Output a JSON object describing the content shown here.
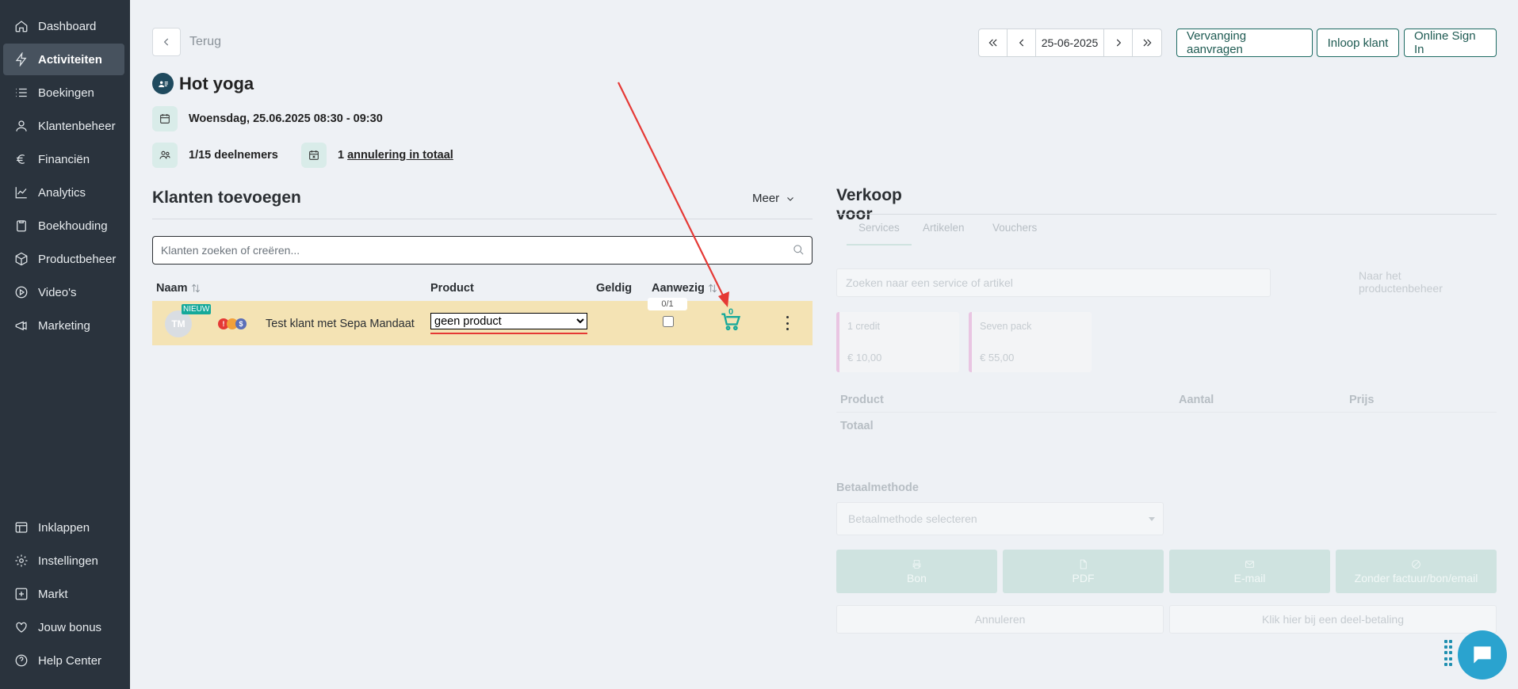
{
  "sidebar": {
    "items": [
      {
        "label": "Dashboard",
        "icon": "home-icon"
      },
      {
        "label": "Activiteiten",
        "icon": "lightning-icon",
        "active": true
      },
      {
        "label": "Boekingen",
        "icon": "list-icon"
      },
      {
        "label": "Klantenbeheer",
        "icon": "user-icon"
      },
      {
        "label": "Financiën",
        "icon": "euro-icon"
      },
      {
        "label": "Analytics",
        "icon": "chart-line-icon"
      },
      {
        "label": "Boekhouding",
        "icon": "clipboard-icon"
      },
      {
        "label": "Productbeheer",
        "icon": "box-icon"
      },
      {
        "label": "Video's",
        "icon": "play-icon"
      },
      {
        "label": "Marketing",
        "icon": "megaphone-icon"
      }
    ],
    "bottom_items": [
      {
        "label": "Inklappen",
        "icon": "collapse-icon"
      },
      {
        "label": "Instellingen",
        "icon": "gear-icon"
      },
      {
        "label": "Markt",
        "icon": "plus-square-icon"
      },
      {
        "label": "Jouw bonus",
        "icon": "heart-icon"
      },
      {
        "label": "Help Center",
        "icon": "help-icon"
      }
    ]
  },
  "header": {
    "back_label": "Terug",
    "date": "25-06-2025",
    "buttons": {
      "replacement": "Vervanging aanvragen",
      "walk_in": "Inloop klant",
      "online_sign_in": "Online Sign In"
    }
  },
  "activity": {
    "title": "Hot yoga",
    "datetime": "Woensdag, 25.06.2025 08:30 - 09:30",
    "participants": "1/15 deelnemers",
    "cancellations_prefix": "1",
    "cancellations_link": "annulering in totaal"
  },
  "customers": {
    "section_title": "Klanten toevoegen",
    "more_label": "Meer",
    "search_placeholder": "Klanten zoeken of creëren...",
    "columns": {
      "name": "Naam",
      "product": "Product",
      "valid": "Geldig",
      "present": "Aanwezig"
    },
    "presence_counter": "0/1",
    "rows": [
      {
        "initials": "TM",
        "badge": "NIEUW",
        "name": "Test klant met Sepa Mandaat",
        "product": "geen product",
        "cart_count": "0",
        "dot_labels": [
          "!",
          "$"
        ]
      }
    ]
  },
  "sale": {
    "title": "Verkoop voor",
    "tabs": [
      "Services",
      "Artikelen",
      "Vouchers"
    ],
    "search_placeholder": "Zoeken naar een service of artikel",
    "product_link": "Naar het productenbeheer",
    "cards": [
      {
        "name": "1 credit",
        "price": "€ 10,00"
      },
      {
        "name": "Seven pack",
        "price": "€ 55,00"
      }
    ],
    "columns": {
      "product": "Product",
      "amount": "Aantal",
      "price": "Prijs"
    },
    "total_label": "Totaal",
    "payment_label": "Betaalmethode",
    "payment_placeholder": "Betaalmethode selecteren",
    "action_buttons": [
      "Bon",
      "PDF",
      "E-mail",
      "Zonder factuur/bon/email"
    ],
    "cancel_label": "Annuleren",
    "partial_label": "Klik hier bij een deel-betaling"
  },
  "colors": {
    "sidebar_bg": "#2a333d",
    "accent": "#16a99a",
    "row_highlight": "#f4e3b4",
    "annotation_red": "#e53935"
  }
}
